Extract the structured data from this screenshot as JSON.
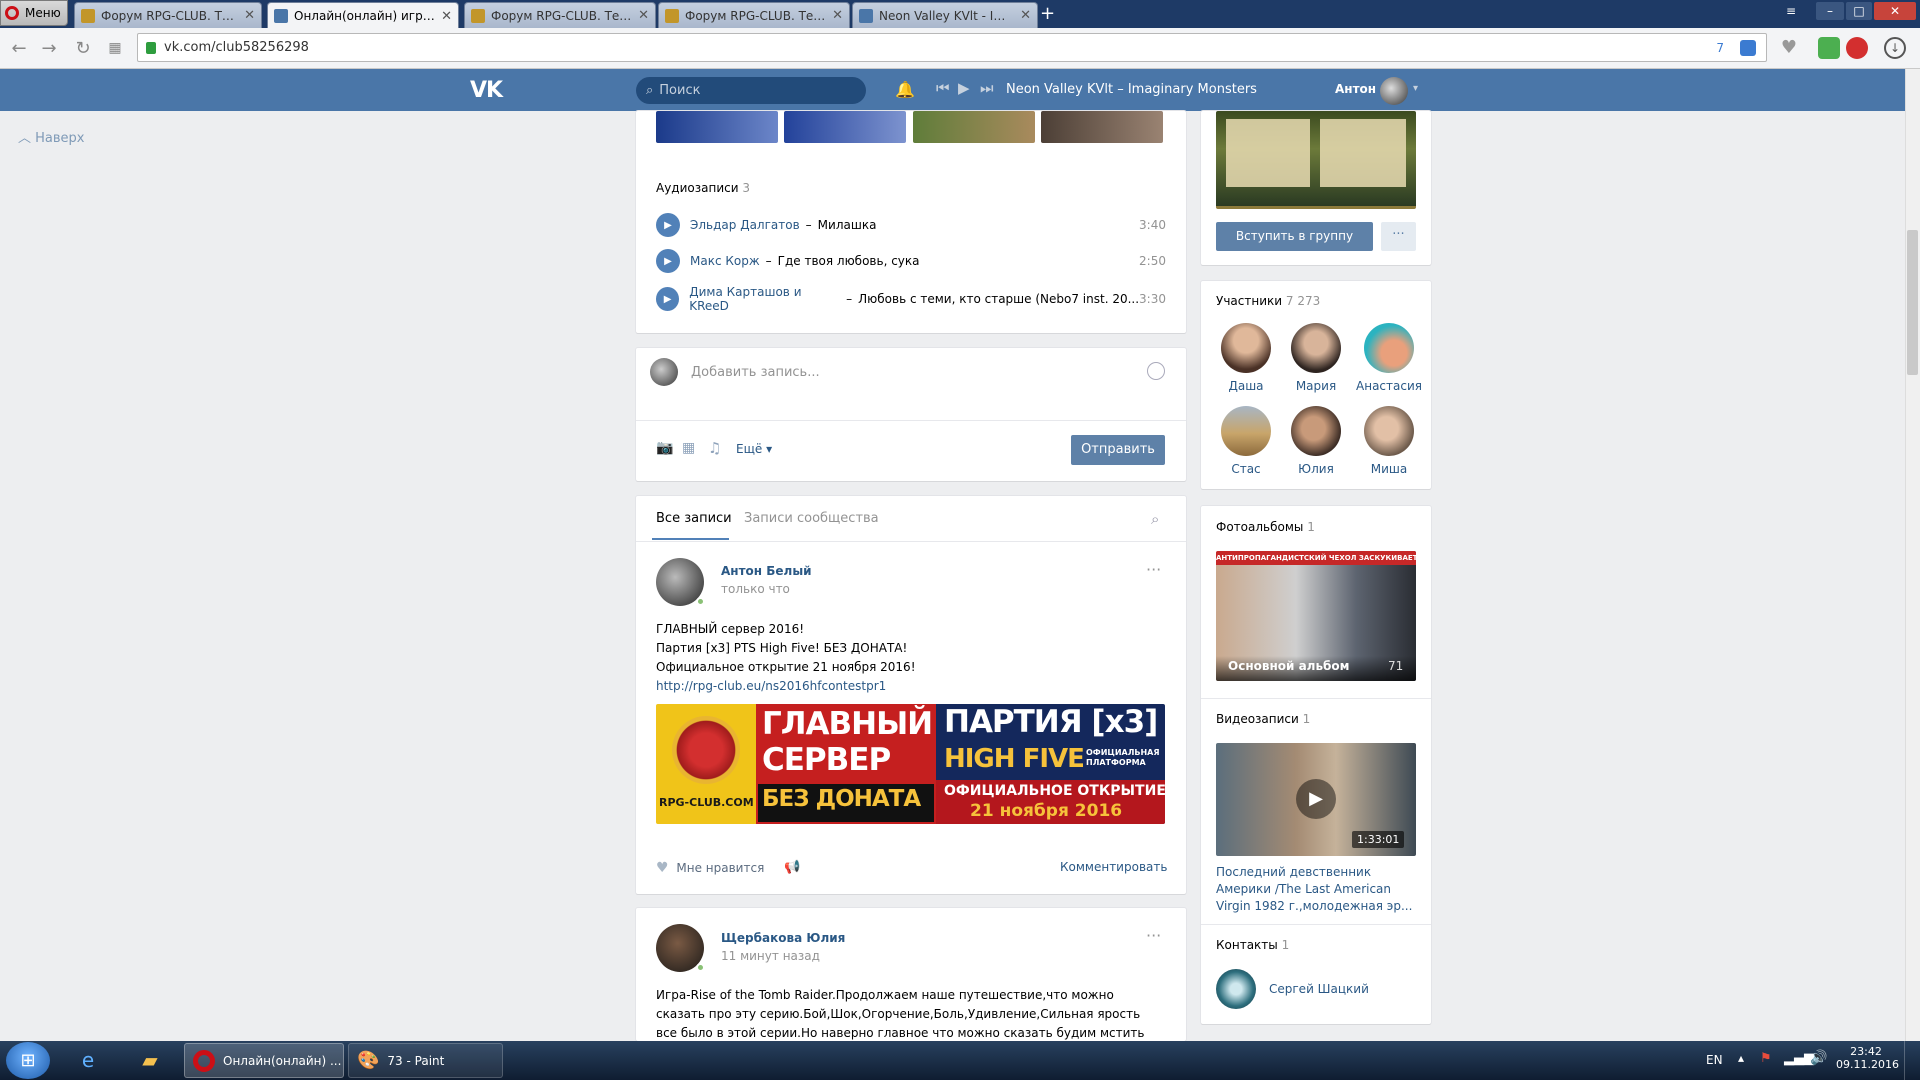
{
  "browser": {
    "menu_label": "Меню",
    "tabs": [
      {
        "title": "Форум RPG-CLUB. Тема: Партия",
        "active": false
      },
      {
        "title": "Онлайн(онлайн) игры,обзоры",
        "active": true
      },
      {
        "title": "Форум RPG-CLUB. Тема: Партия",
        "active": false
      },
      {
        "title": "Форум RPG-CLUB. Тема: Партия",
        "active": false
      },
      {
        "title": "Neon Valley KVlt - Imaginary",
        "active": false
      }
    ],
    "url": "vk.com/club58256298",
    "badge_count": "7"
  },
  "vk_header": {
    "logo": "VK",
    "search_placeholder": "Поиск",
    "now_playing": "Neon Valley KVlt – Imaginary Monsters",
    "user_name": "Антон"
  },
  "sidebar": {
    "up_label": "Наверх"
  },
  "audio": {
    "title": "Аудиозаписи",
    "count": "3",
    "tracks": [
      {
        "artist": "Эльдар Далгатов",
        "title": "Милашка",
        "duration": "3:40"
      },
      {
        "artist": "Макс Корж",
        "title": "Где твоя любовь, сука",
        "duration": "2:50"
      },
      {
        "artist": "Дима Карташов и KReeD",
        "title": "Любовь с теми, кто старше (Nebo7 inst. 20...",
        "duration": "3:30"
      }
    ]
  },
  "composer": {
    "placeholder": "Добавить запись...",
    "more_label": "Ещё",
    "send_label": "Отправить"
  },
  "wall": {
    "tabs": [
      "Все записи",
      "Записи сообщества"
    ],
    "posts": [
      {
        "author": "Антон Белый",
        "time": "только что",
        "lines": [
          "ГЛАВНЫЙ сервер 2016!",
          "Партия [x3] PTS High Five! БЕЗ ДОНАТА!",
          "Официальное открытие 21 ноября 2016!"
        ],
        "link": "http://rpg-club.eu/ns2016hfcontestpr1",
        "banner": {
          "logo_text": "RPG-CLUB.COM",
          "left_line1": "ГЛАВНЫЙ",
          "left_line2": "СЕРВЕР",
          "left_line3": "БЕЗ ДОНАТА",
          "right_line1": "ПАРТИЯ [x3]",
          "right_line2": "HIGH FIVE",
          "right_small": "ОФИЦИАЛЬНАЯ ПЛАТФОРМА",
          "right_line3": "ОФИЦИАЛЬНОЕ ОТКРЫТИЕ",
          "right_line4": "21 ноября 2016"
        },
        "like_label": "Мне нравится",
        "comment_label": "Комментировать"
      },
      {
        "author": "Щербакова Юлия",
        "time": "11 минут назад",
        "text": "Игра-Rise of the Tomb Raider.Продолжаем наше путешествие,что можно сказать про эту серию.Бой,Шок,Огорчение,Боль,Удивление,Сильная ярость все было в этой серии.Но наверно главное что можно сказать будим мстить Костику.А как"
      }
    ]
  },
  "right": {
    "join_label": "Вступить в группу",
    "members": {
      "title": "Участники",
      "count": "7 273",
      "people": [
        "Даша",
        "Мария",
        "Анастасия",
        "Стас",
        "Юлия",
        "Миша"
      ]
    },
    "albums": {
      "title": "Фотоальбомы",
      "count": "1",
      "album_name": "Основной альбом",
      "album_count": "71",
      "banner_text": "АНТИПРОПАГАНДИСТСКИЙ ЧЕХОЛ ЗАСКУКИВАЕТ ВНИМАНИЯ!"
    },
    "videos": {
      "title": "Видеозаписи",
      "count": "1",
      "duration": "1:33:01",
      "caption": "Последний девственник Америки /The Last American Virgin 1982 г.,молодежная эр..."
    },
    "contacts": {
      "title": "Контакты",
      "count": "1",
      "name": "Сергей Шацкий"
    }
  },
  "taskbar": {
    "apps": [
      "Онлайн(онлайн) ...",
      "73 - Paint"
    ],
    "lang": "EN",
    "time": "23:42",
    "date": "09.11.2016"
  },
  "colors": {
    "vk_blue": "#4a76a8",
    "link": "#2a5885",
    "button": "#5e81a8"
  }
}
